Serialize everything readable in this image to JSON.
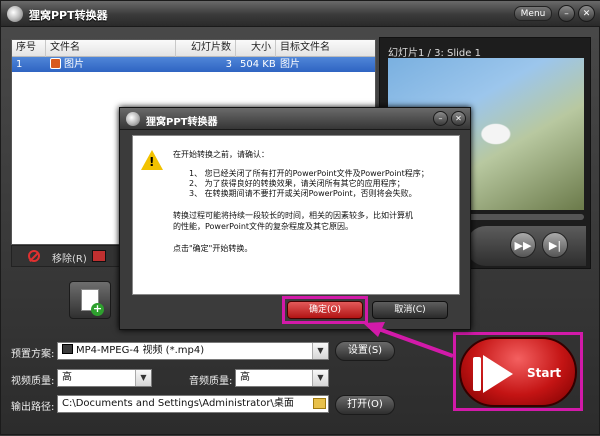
{
  "window": {
    "title": "狸窝PPT转换器",
    "menu_label": "Menu",
    "minimize_glyph": "–",
    "close_glyph": "✕"
  },
  "file_list": {
    "columns": [
      "序号",
      "文件名",
      "幻灯片数",
      "大小",
      "目标文件名"
    ],
    "rows": [
      {
        "index": "1",
        "filename": "图片",
        "slides": "3",
        "size": "504 KB",
        "target": "图片"
      }
    ]
  },
  "list_strip": {
    "remove_label": "移除(R)"
  },
  "preview": {
    "label": "幻灯片1 / 3: Slide 1",
    "next_glyph": "▶▶",
    "end_glyph": "▶|"
  },
  "settings": {
    "preset_label": "预置方案:",
    "preset_value": "MP4-MPEG-4 视频 (*.mp4)",
    "settings_button": "设置(S)",
    "video_quality_label": "视频质量:",
    "video_quality_value": "高",
    "audio_quality_label": "音频质量:",
    "audio_quality_value": "高",
    "output_label": "输出路径:",
    "output_path": "C:\\Documents and Settings\\Administrator\\桌面",
    "open_button": "打开(O)"
  },
  "start": {
    "label": "Start"
  },
  "dialog": {
    "title": "狸窝PPT转换器",
    "intro": "在开始转换之前，请确认：",
    "items": [
      "1、  您已经关闭了所有打开的PowerPoint文件及PowerPoint程序；",
      "2、  为了获得良好的转换效果，请关闭所有其它的应用程序；",
      "3、  在转换期间请不要打开或关闭PowerPoint，否则将会失败。"
    ],
    "note_line1": "转换过程可能将持续一段较长的时间，相关的因素较多，比如计算机",
    "note_line2": "的性能，PowerPoint文件的复杂程度及其它原因。",
    "prompt": "点击\"确定\"开始转换。",
    "ok_button": "确定(O)",
    "cancel_button": "取消(C)"
  },
  "colors": {
    "highlight": "#d21aa9",
    "start_red": "#c41414",
    "selection_blue": "#2f64c2"
  },
  "icons": [
    "logo-icon",
    "ppt-file-icon",
    "remove-icon",
    "add-file-icon",
    "warning-icon",
    "folder-icon",
    "play-icon"
  ]
}
